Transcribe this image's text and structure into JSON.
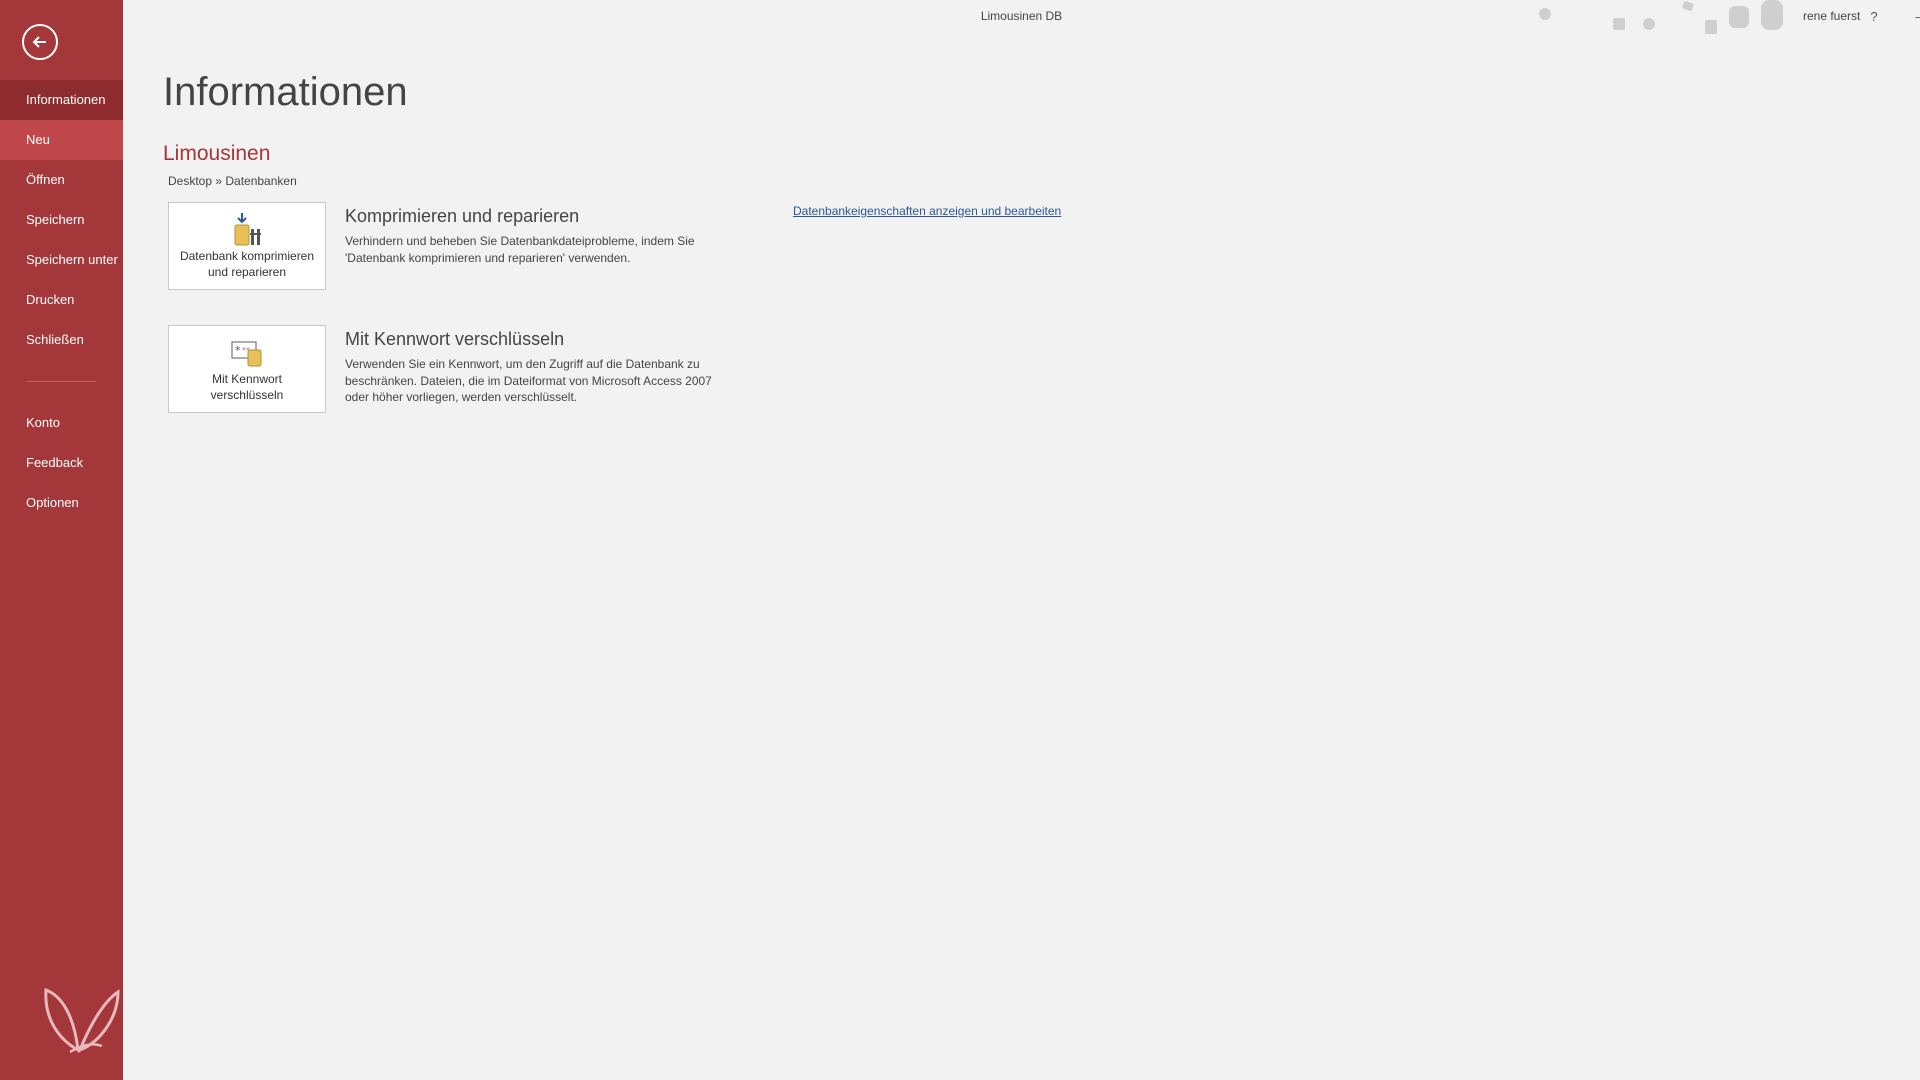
{
  "window": {
    "title": "Limousinen DB",
    "user": "rene fuerst",
    "help_label": "?",
    "minimize_label": "–",
    "restore_label": "❐",
    "close_label": "✕"
  },
  "sidebar": {
    "items": [
      {
        "label": "Informationen"
      },
      {
        "label": "Neu"
      },
      {
        "label": "Öffnen"
      },
      {
        "label": "Speichern"
      },
      {
        "label": "Speichern unter"
      },
      {
        "label": "Drucken"
      },
      {
        "label": "Schließen"
      },
      {
        "label": "Konto"
      },
      {
        "label": "Feedback"
      },
      {
        "label": "Optionen"
      }
    ],
    "selected": "Informationen",
    "hovered": "Neu"
  },
  "main": {
    "page_title": "Informationen",
    "db_name": "Limousinen",
    "db_path": "Desktop » Datenbanken",
    "compact": {
      "tile_label_line1": "Datenbank komprimieren",
      "tile_label_line2": "und reparieren",
      "heading": "Komprimieren und reparieren",
      "description": "Verhindern und beheben Sie Datenbankdateiprobleme, indem Sie 'Datenbank komprimieren und reparieren' verwenden."
    },
    "encrypt": {
      "tile_label_line1": "Mit Kennwort",
      "tile_label_line2": "verschlüsseln",
      "heading": "Mit Kennwort verschlüsseln",
      "description": "Verwenden Sie ein Kennwort, um den Zugriff auf die Datenbank zu beschränken. Dateien, die im Dateiformat von Microsoft Access 2007 oder höher vorliegen, werden verschlüsselt."
    },
    "properties_link": "Datenbankeigenschaften anzeigen und bearbeiten"
  },
  "colors": {
    "accent": "#a4373a",
    "sidebar_selected": "#8e2b2e",
    "sidebar_hover": "#c0474b",
    "background": "#f2f2f2",
    "link": "#2b579a"
  },
  "icons": {
    "back": "back-arrow-icon",
    "compact": "compact-repair-icon",
    "encrypt": "encrypt-password-icon",
    "logo": "butterfly-logo-icon",
    "decoration": "doodle-pattern-icon"
  }
}
